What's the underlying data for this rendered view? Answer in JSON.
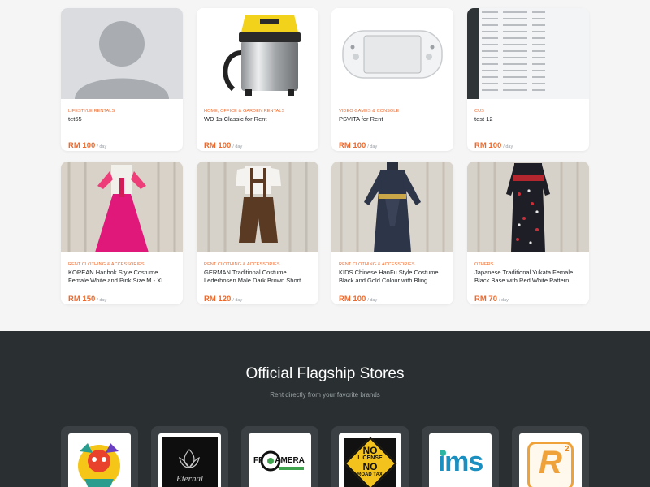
{
  "products": [
    {
      "category": "LIFESTYLE RENTALS",
      "title": "tet65",
      "price": "RM 100",
      "unit": "/ day"
    },
    {
      "category": "HOME, OFFICE & GARDEN RENTALS",
      "title": "WD 1s Classic for Rent",
      "price": "RM 100",
      "unit": "/ day"
    },
    {
      "category": "VIDEO GAMES & CONSOLE",
      "title": "PSVITA for Rent",
      "price": "RM 100",
      "unit": "/ day"
    },
    {
      "category": "CUS",
      "title": "test 12",
      "price": "RM 100",
      "unit": "/ day"
    },
    {
      "category": "RENT CLOTHING & ACCESSORIES",
      "title": "KOREAN Hanbok Style Costume Female White and Pink Size M - XL...",
      "price": "RM 150",
      "unit": "/ day"
    },
    {
      "category": "RENT CLOTHING & ACCESSORIES",
      "title": "GERMAN Traditional Costume Lederhosen Male Dark Brown Short...",
      "price": "RM 120",
      "unit": "/ day"
    },
    {
      "category": "RENT CLOTHING & ACCESSORIES",
      "title": "KIDS Chinese HanFu Style Costume Black and Gold Colour with Bling...",
      "price": "RM 100",
      "unit": "/ day"
    },
    {
      "category": "OTHERS",
      "title": "Japanese Traditional Yukata Female Black Base with Red White Pattern...",
      "price": "RM 70",
      "unit": "/ day"
    }
  ],
  "flagship": {
    "title": "Official Flagship Stores",
    "subtitle": "Rent directly from your favorite brands",
    "stores": [
      {
        "logo_icon": "colorful-character-logo"
      },
      {
        "logo_icon": "eternal-lotus-logo",
        "logo_text": "Eternal"
      },
      {
        "logo_icon": "ffcamera-logo",
        "logo_text_a": "FF",
        "logo_text_b": "AMERA"
      },
      {
        "logo_icon": "no-license-no-road-tax-logo",
        "logo_text_a": "NO",
        "logo_text_b": "LICENSE",
        "logo_text_c": "NO",
        "logo_text_d": "ROAD TAX"
      },
      {
        "logo_icon": "ims-logo",
        "logo_text": "ims"
      },
      {
        "logo_icon": "r-squared-logo",
        "logo_text": "R"
      }
    ]
  },
  "colors": {
    "accent": "#ee6a2c",
    "dark_section": "#2a2f31",
    "card_bg": "#ffffff",
    "page_bg": "#f5f5f5"
  }
}
